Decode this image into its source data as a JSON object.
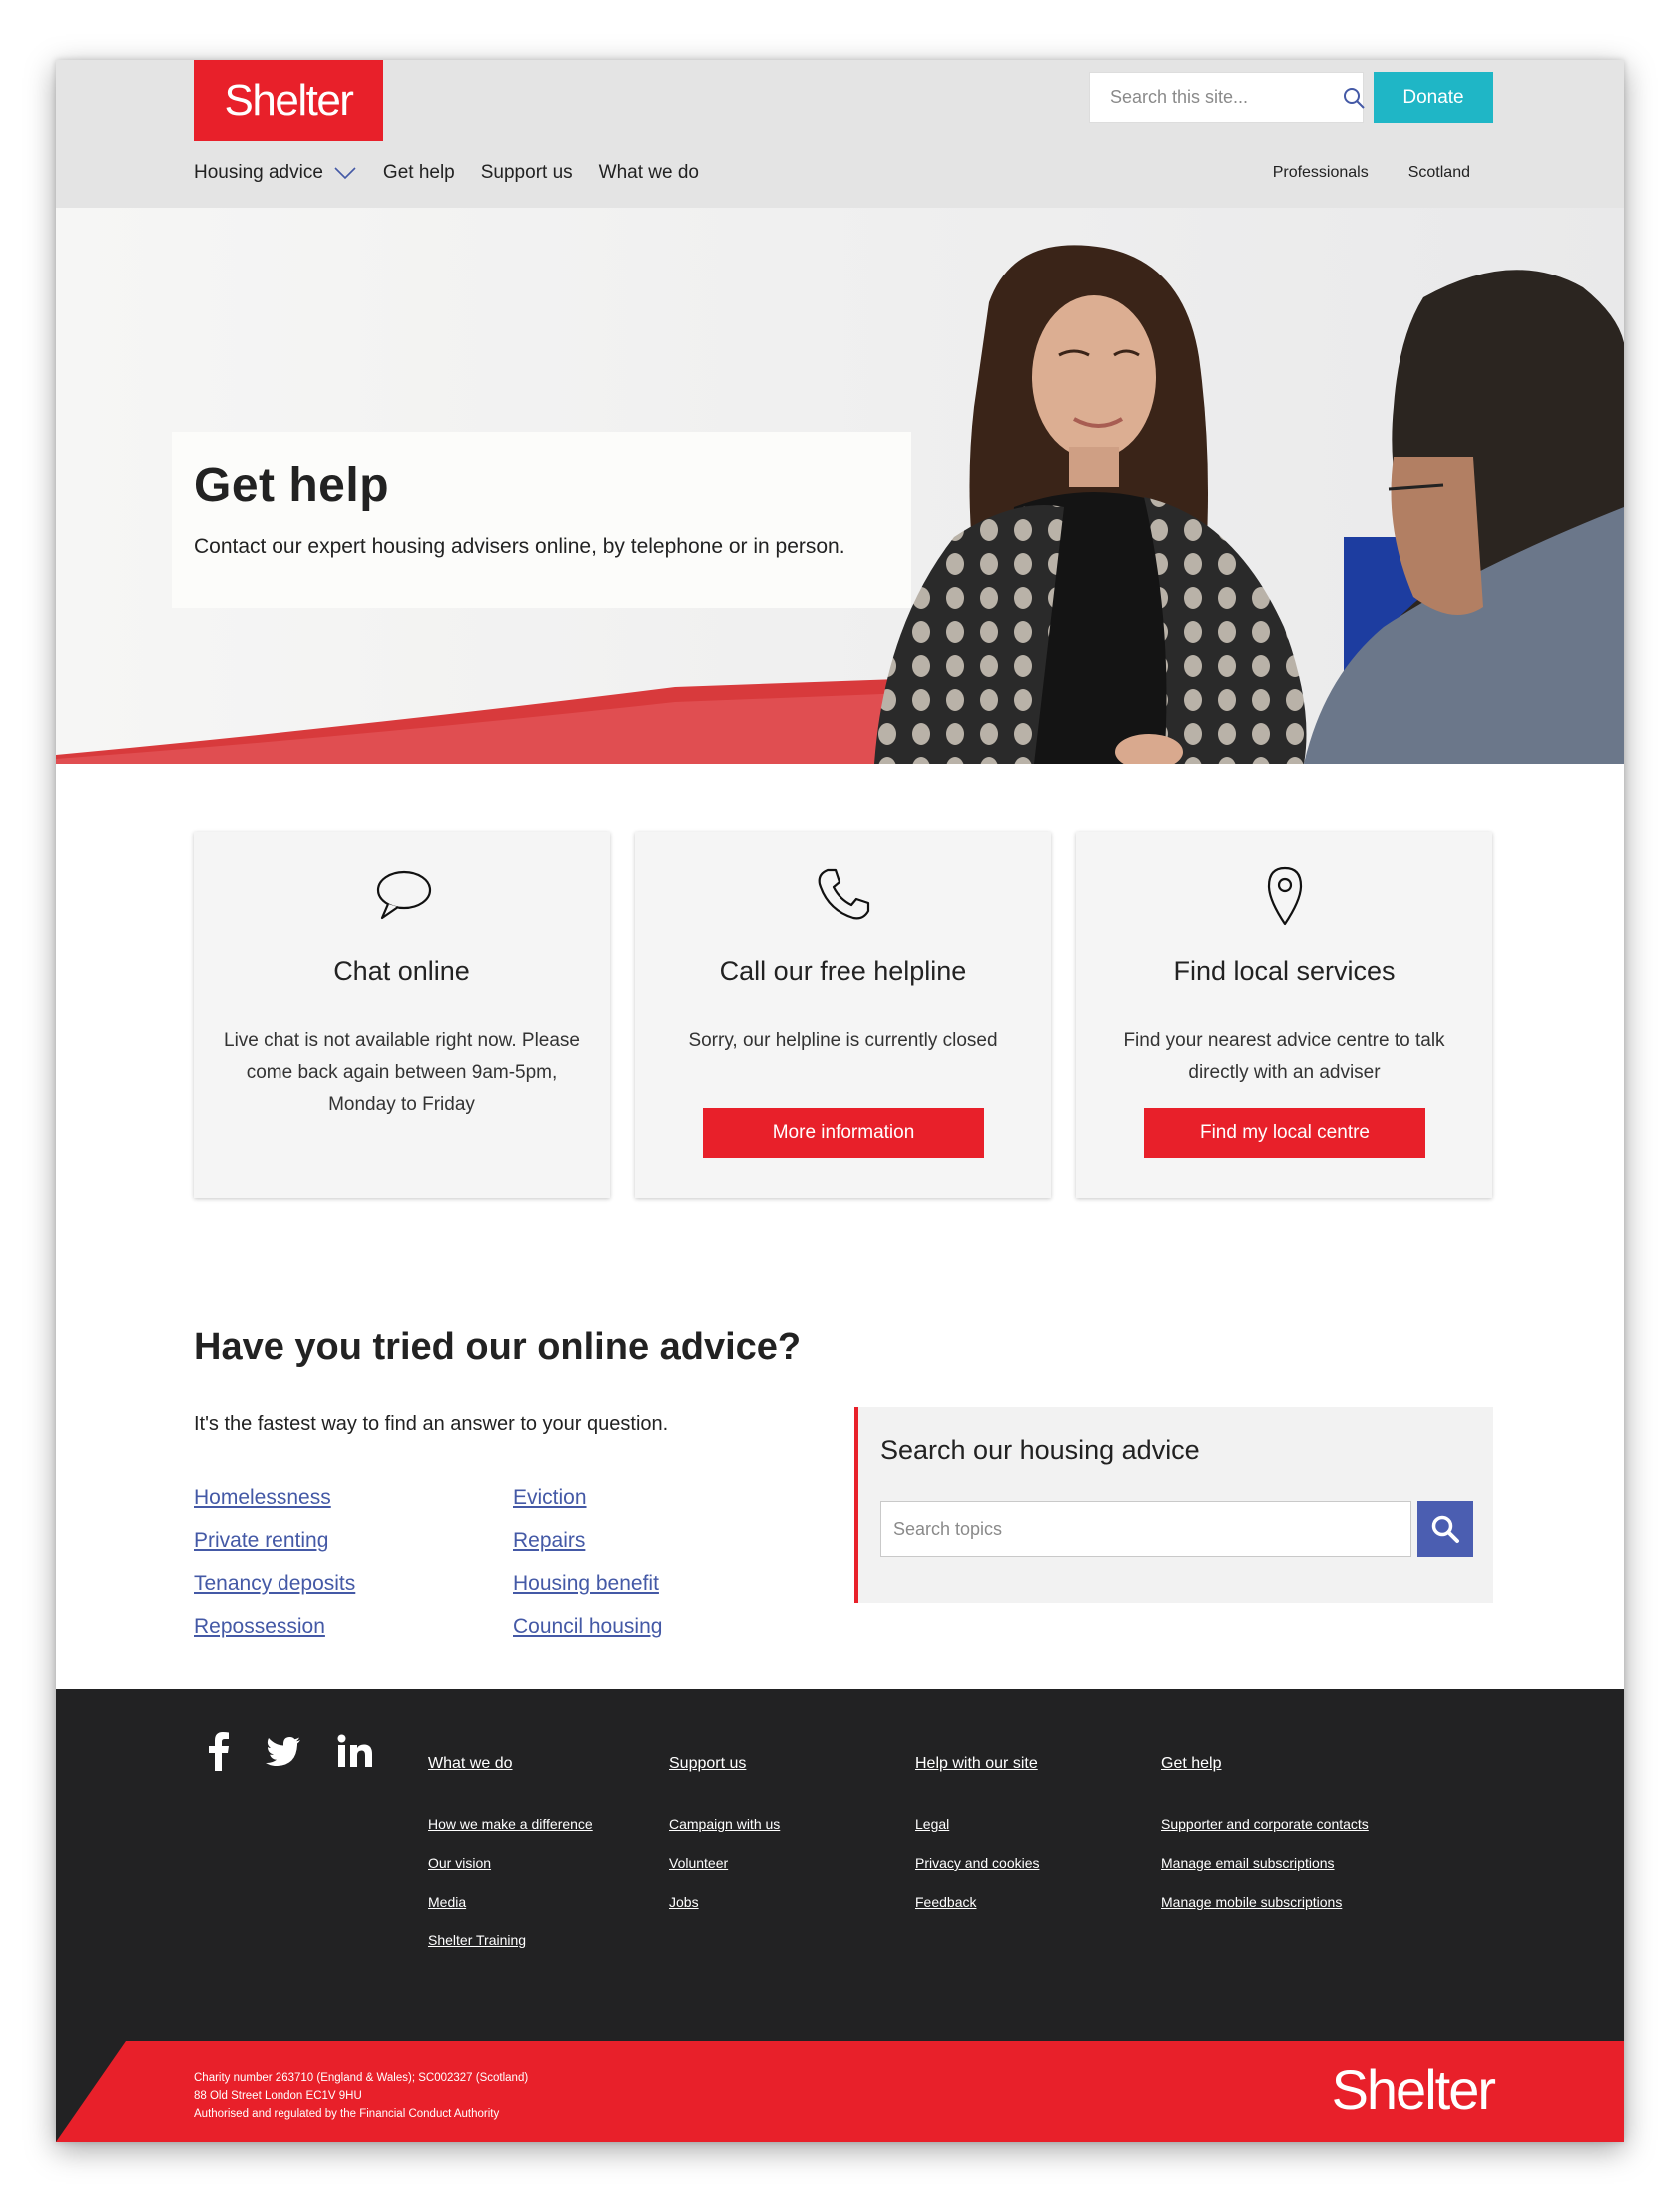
{
  "brand": {
    "logo_text": "Shelter",
    "accent": "#e8202a",
    "teal": "#1fb6c6",
    "link": "#4459a6"
  },
  "header": {
    "search_placeholder": "Search this site...",
    "donate_label": "Donate",
    "nav": [
      {
        "label": "Housing advice",
        "has_dropdown": true
      },
      {
        "label": "Get help"
      },
      {
        "label": "Support us"
      },
      {
        "label": "What we do"
      }
    ],
    "nav_right": [
      {
        "label": "Professionals"
      },
      {
        "label": "Scotland"
      }
    ]
  },
  "hero": {
    "title": "Get help",
    "subtitle": "Contact our expert housing advisers online, by telephone or in person."
  },
  "cards": [
    {
      "icon": "chat-bubble-icon",
      "title": "Chat online",
      "text": "Live chat is not available right now. Please come back again between 9am-5pm, Monday to Friday"
    },
    {
      "icon": "phone-icon",
      "title": "Call our free helpline",
      "text": "Sorry, our helpline is currently closed",
      "button": "More information"
    },
    {
      "icon": "location-pin-icon",
      "title": "Find local services",
      "text": "Find your nearest advice centre to talk directly with an adviser",
      "button": "Find my local centre"
    }
  ],
  "advice": {
    "title": "Have you tried our online advice?",
    "subtitle": "It's the fastest way to find an answer to your question.",
    "links_col1": [
      "Homelessness",
      "Private renting",
      "Tenancy deposits",
      "Repossession"
    ],
    "links_col2": [
      "Eviction",
      "Repairs",
      "Housing benefit",
      "Council housing"
    ],
    "search_title": "Search our housing advice",
    "search_placeholder": "Search topics"
  },
  "footer": {
    "social": [
      "facebook-icon",
      "twitter-icon",
      "linkedin-icon"
    ],
    "columns": [
      {
        "heading": "What we do",
        "links": [
          "How we make a difference",
          "Our vision",
          "Media",
          "Shelter Training"
        ]
      },
      {
        "heading": "Support us",
        "links": [
          "Campaign with us",
          "Volunteer",
          "Jobs"
        ]
      },
      {
        "heading": "Help with our site",
        "links": [
          "Legal",
          "Privacy and cookies",
          "Feedback"
        ]
      },
      {
        "heading": "Get help",
        "links": [
          "Supporter and corporate contacts",
          "Manage email subscriptions",
          "Manage mobile subscriptions"
        ]
      }
    ],
    "legal": [
      "Charity number 263710 (England & Wales); SC002327 (Scotland)",
      "88 Old Street London EC1V 9HU",
      "Authorised and regulated by the Financial Conduct Authority"
    ],
    "logo_text": "Shelter"
  }
}
